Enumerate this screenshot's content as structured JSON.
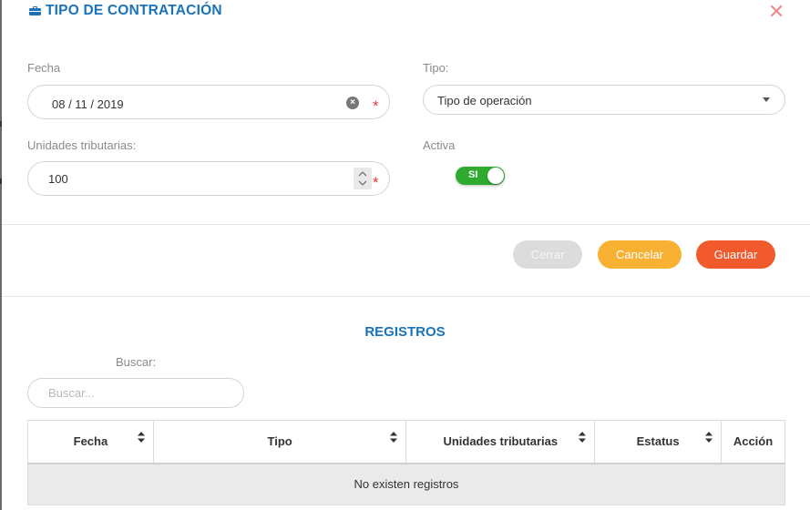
{
  "modal": {
    "title": "TIPO DE CONTRATACIÓN",
    "close_glyph": "✕"
  },
  "form": {
    "fecha": {
      "label": "Fecha",
      "value": "08 / 11 / 2019",
      "required_mark": "*"
    },
    "tipo": {
      "label": "Tipo:",
      "value": "Tipo de operación"
    },
    "unidades": {
      "label": "Unidades tributarias:",
      "value": "100",
      "required_mark": "*"
    },
    "activa": {
      "label": "Activa",
      "toggle_label": "SI",
      "toggle_on": true
    }
  },
  "buttons": {
    "cerrar": "Cerrar",
    "cancelar": "Cancelar",
    "guardar": "Guardar"
  },
  "registros": {
    "title": "REGISTROS",
    "search_label": "Buscar:",
    "search_placeholder": "Buscar...",
    "columns": [
      "Fecha",
      "Tipo",
      "Unidades tributarias",
      "Estatus",
      "Acción"
    ],
    "empty_message": "No existen registros"
  },
  "colors": {
    "accent_blue": "#1a73b8",
    "toggle_green": "#2eaa2e",
    "cancel_orange": "#f8b133",
    "save_red": "#f05a2c",
    "close_red": "#f18b8b",
    "required_red": "#e53935"
  },
  "icons": {
    "title": "briefcase-icon",
    "close": "close-icon",
    "clear": "clear-circle-icon",
    "spinner": "number-spinner-icon",
    "select": "caret-down-icon",
    "sort": "sort-icon"
  }
}
